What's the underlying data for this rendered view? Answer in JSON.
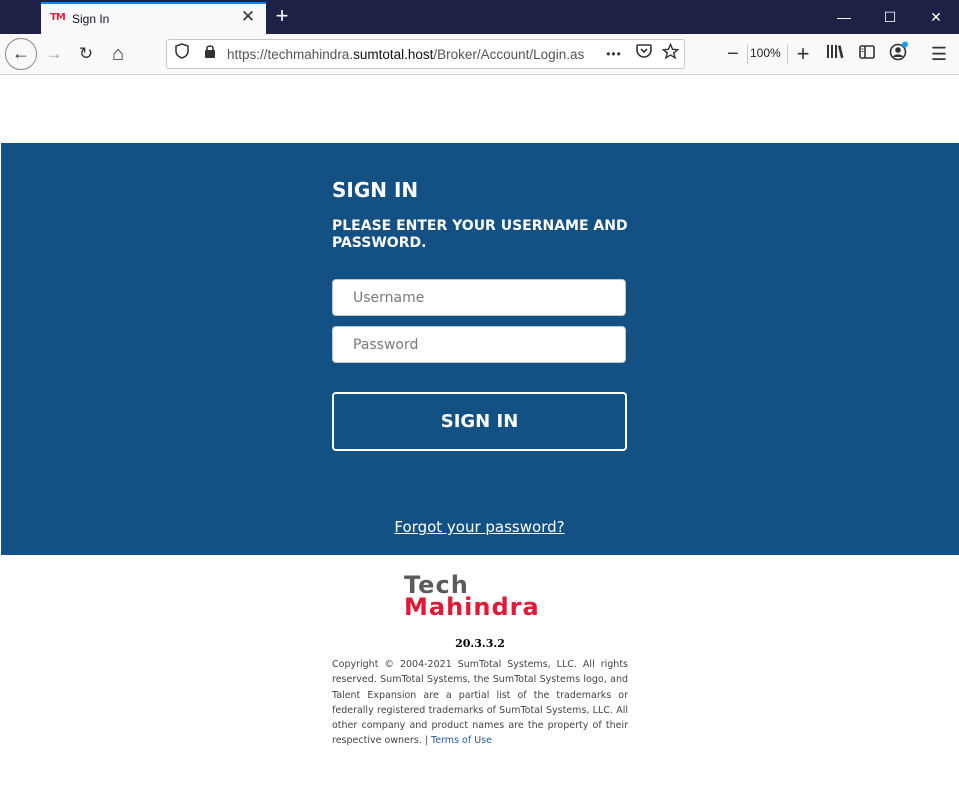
{
  "browser": {
    "tab_favicon": "TM",
    "tab_title": "Sign In",
    "tab_close": "✕",
    "new_tab": "+",
    "window": {
      "minimize": "—",
      "maximize": "☐",
      "close": "✕"
    },
    "nav": {
      "back": "←",
      "forward": "→",
      "reload": "↻",
      "home": "⌂"
    },
    "url_prefix": "https://techmahindra.",
    "url_host": "sumtotal.host",
    "url_path": "/Broker/Account/Login.as",
    "page_actions": "•••",
    "zoom_level": "100%",
    "zoom_out": "−",
    "zoom_in": "+",
    "menu": "☰"
  },
  "login": {
    "heading": "SIGN IN",
    "subheading": "PLEASE ENTER YOUR USERNAME AND PASSWORD.",
    "username_placeholder": "Username",
    "password_placeholder": "Password",
    "submit_label": "SIGN IN",
    "forgot_link": "Forgot your password?"
  },
  "footer": {
    "logo_line1": "Tech",
    "logo_line2": "Mahindra",
    "version": "20.3.3.2",
    "copyright": "Copyright © 2004-2021 SumTotal Systems, LLC. All rights reserved. SumTotal Systems, the SumTotal Systems logo, and Talent Expansion are a partial list of the trademarks or federally registered trademarks of SumTotal Systems, LLC. All other company and product names are the property of their respective owners. | ",
    "terms_link": "Terms of Use"
  },
  "colors": {
    "brand_blue": "#135184",
    "logo_red": "#e31837",
    "logo_gray": "#5b5b5f",
    "titlebar": "#1e2146"
  }
}
